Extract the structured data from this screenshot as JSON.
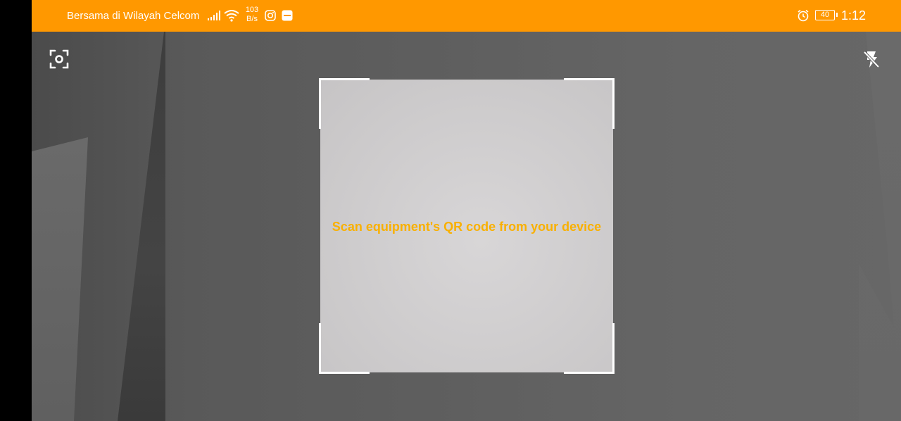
{
  "status_bar": {
    "carrier": "Bersama di Wilayah Celcom",
    "net_speed_value": "103",
    "net_speed_unit": "B/s",
    "battery_level": "40",
    "time": "1:12",
    "icons": [
      "signal-icon",
      "wifi-icon",
      "instagram-icon",
      "notification-app-icon",
      "alarm-icon",
      "battery-icon"
    ],
    "background_color": "#FF9800"
  },
  "scanner": {
    "instruction": "Scan equipment's QR code from your device",
    "instruction_color": "#F9B000",
    "frame_color": "#FFFFFF"
  },
  "controls": {
    "switch_camera_icon": "switch-camera-icon",
    "flash_icon": "flash-off-icon"
  }
}
